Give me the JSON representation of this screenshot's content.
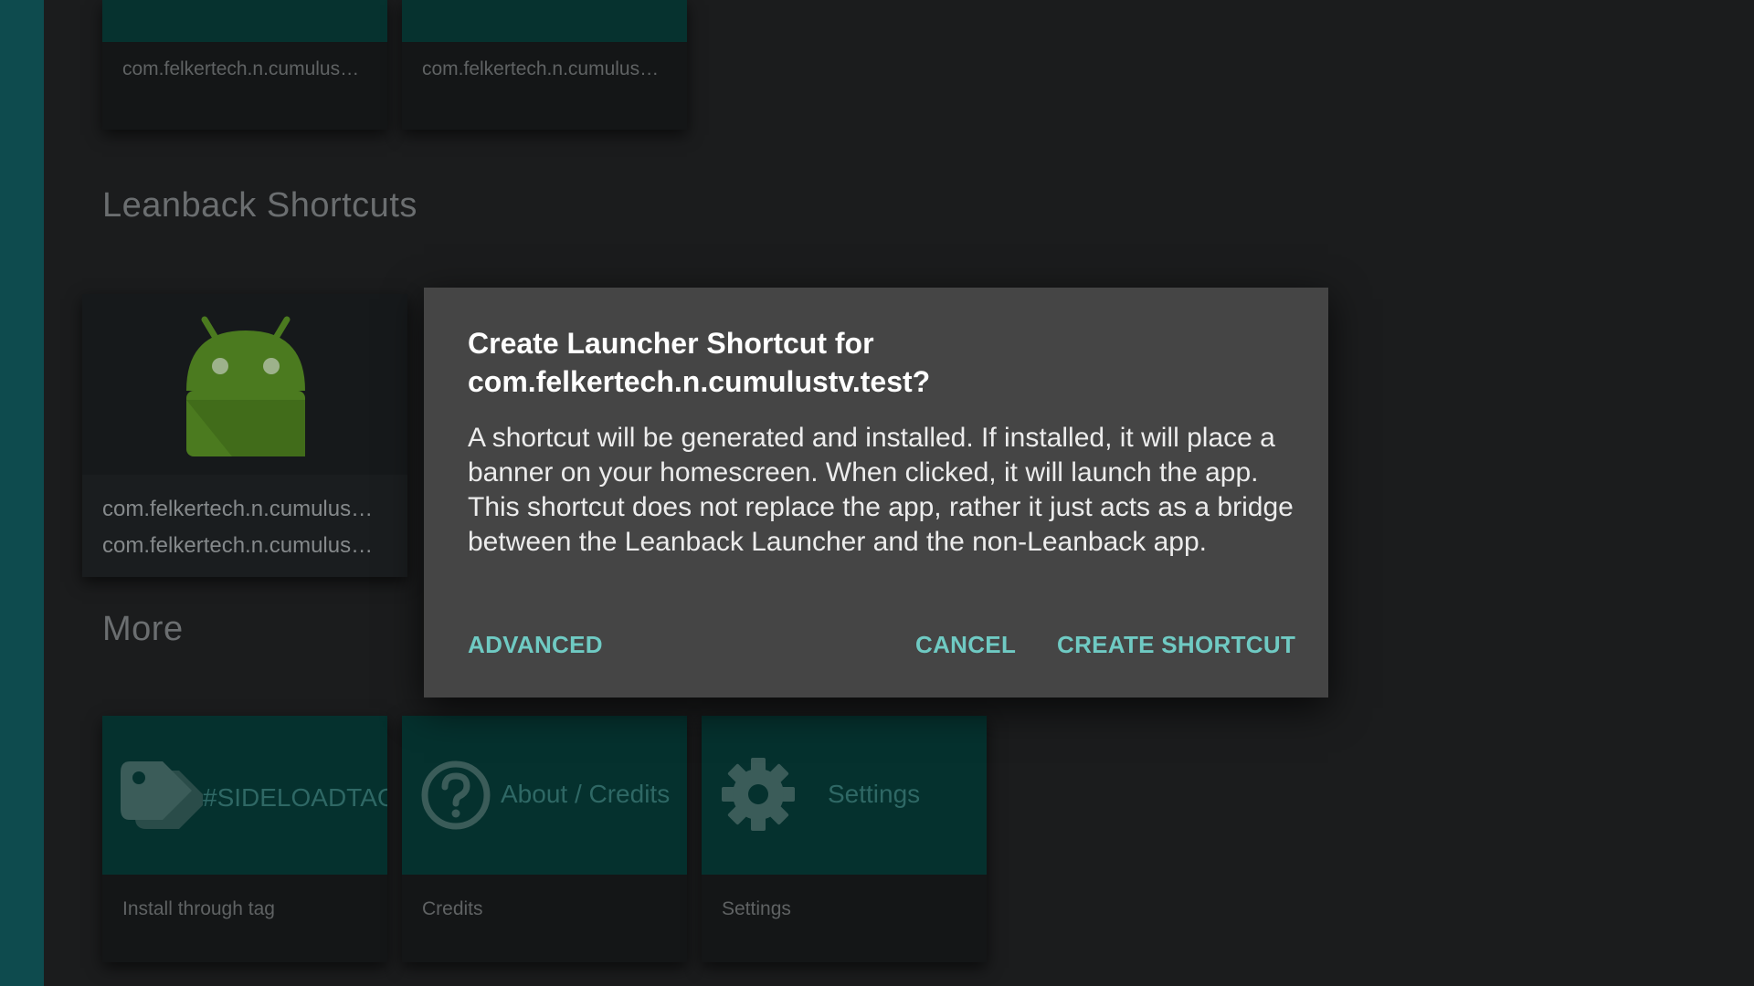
{
  "top_row": {
    "cards": [
      {
        "subtitle": "com.felkertech.n.cumulus…"
      },
      {
        "subtitle": "com.felkertech.n.cumulus…"
      }
    ]
  },
  "leanback": {
    "title": "Leanback Shortcuts",
    "card": {
      "icon": "android-icon",
      "title": "com.felkertech.n.cumulus…",
      "subtitle": "com.felkertech.n.cumulus…"
    }
  },
  "more": {
    "title": "More",
    "cards": [
      {
        "icon": "tag-icon",
        "banner_label": "#SIDELOADTAGS",
        "subtitle": "Install through tag"
      },
      {
        "icon": "help-circle-icon",
        "banner_label": "About / Credits",
        "subtitle": "Credits"
      },
      {
        "icon": "gear-icon",
        "banner_label": "Settings",
        "subtitle": "Settings"
      }
    ]
  },
  "dialog": {
    "title_line1": "Create Launcher Shortcut for",
    "title_line2": "com.felkertech.n.cumulustv.test?",
    "body": "A shortcut will be generated and installed. If installed, it will place a banner on your homescreen. When clicked, it will launch the app. This shortcut does not replace the app, rather it just acts as a bridge between the Leanback Launcher and the non-Leanback app.",
    "buttons": {
      "advanced": "ADVANCED",
      "cancel": "CANCEL",
      "create": "CREATE SHORTCUT"
    }
  },
  "colors": {
    "accent": "#6fcac3",
    "rail": "#0e4b4e",
    "dialog_bg": "#454545",
    "android_green": "#4b7a1f"
  }
}
